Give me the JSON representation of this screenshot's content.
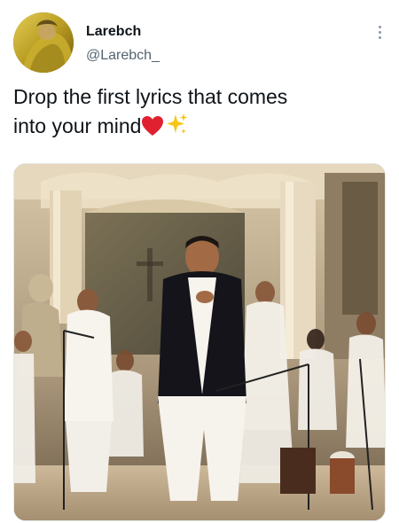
{
  "user": {
    "display_name": "Larebch",
    "handle": "@Larebch_",
    "avatar_icon": "profile-avatar-yellow-dupatta"
  },
  "tweet": {
    "text": "Drop the first lyrics that comes\ninto your mind",
    "emojis": [
      "red-heart-icon",
      "sparkles-icon"
    ]
  },
  "media": {
    "type": "photo",
    "description_icon": "concert-photo"
  },
  "menu": {
    "icon": "more-vertical-icon"
  },
  "colors": {
    "text": "#0f1419",
    "secondary": "#536471",
    "heart": "#e0212f",
    "sparkle": "#f5c518"
  }
}
